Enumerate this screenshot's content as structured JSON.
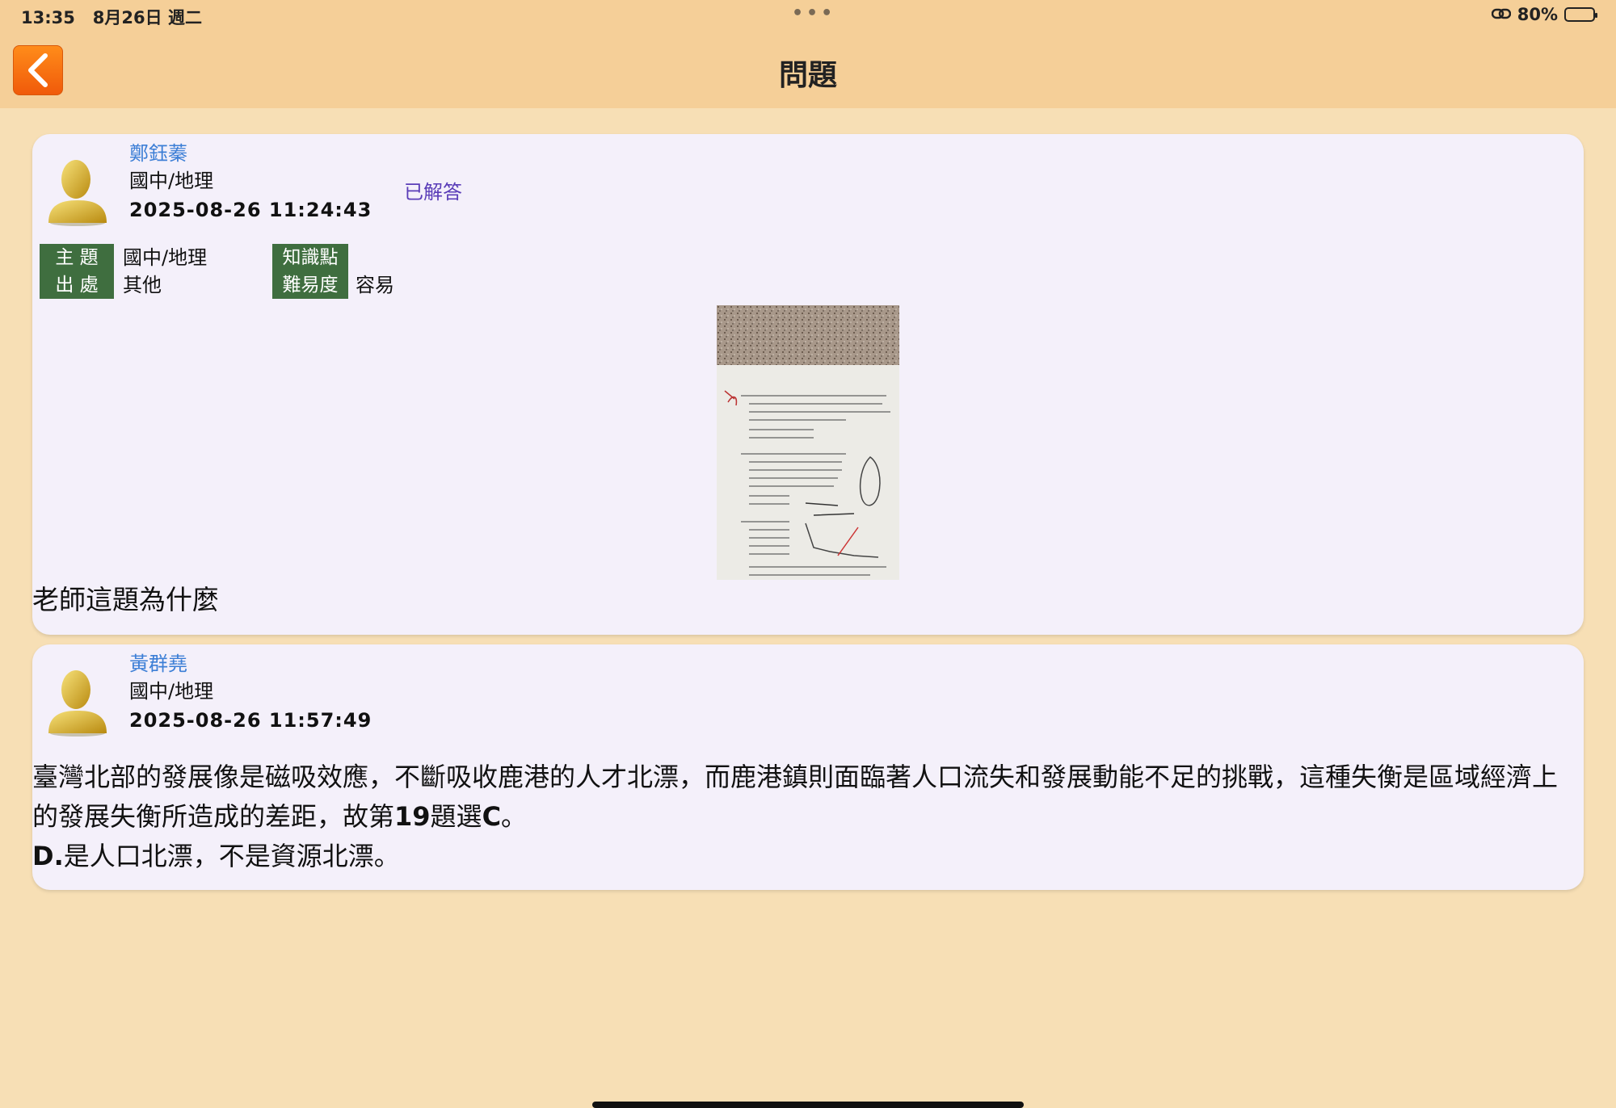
{
  "status_bar": {
    "time": "13:35",
    "date": "8月26日 週二",
    "dots": "•••",
    "battery_text": "80%",
    "battery_level": 0.8
  },
  "nav": {
    "title": "問題"
  },
  "question": {
    "user_name": "鄭鈺蓁",
    "subject": "國中/地理",
    "timestamp": "2025-08-26 11:24:43",
    "status": "已解答",
    "meta": {
      "topic_label": "主 題",
      "topic_value": "國中/地理",
      "source_label": "出 處",
      "source_value": "其他",
      "knowledge_label": "知識點",
      "knowledge_value": "",
      "difficulty_label": "難易度",
      "difficulty_value": "容易"
    },
    "text": "老師這題為什麼"
  },
  "answer": {
    "user_name": "黃群堯",
    "subject": "國中/地理",
    "timestamp": "2025-08-26 11:57:49",
    "line1": "臺灣北部的發展像是磁吸效應，不斷吸收鹿港的人才北漂，而鹿港鎮則面臨著人口流失和發展動能不足的挑戰，這種失衡是區域經濟上的發展失衡所造成的差距，故第",
    "num": "19",
    "mid": "題選",
    "letter": "C",
    "end": "。",
    "line2_bold": "D.",
    "line2": "是人口北漂，不是資源北漂。"
  },
  "colors": {
    "background": "#f7dfb5",
    "header": "#f5cf98",
    "card": "#f4f0fa",
    "username": "#3d7fd6",
    "status": "#5a3db8",
    "tag_bg": "#3f6e3f",
    "back_button": "#f26a10"
  }
}
